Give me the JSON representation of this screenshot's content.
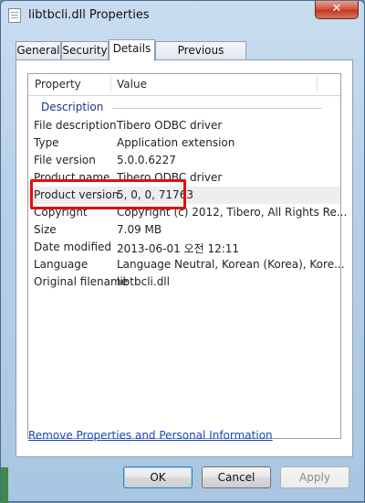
{
  "window": {
    "title": "libtbcli.dll Properties",
    "close_glyph": "✕"
  },
  "tabs": [
    {
      "label": "General"
    },
    {
      "label": "Security"
    },
    {
      "label": "Details",
      "active": true
    },
    {
      "label": "Previous Versions"
    }
  ],
  "list": {
    "columns": {
      "property": "Property",
      "value": "Value"
    },
    "group": "Description",
    "rows": [
      {
        "property": "File description",
        "value": "Tibero ODBC driver"
      },
      {
        "property": "Type",
        "value": "Application extension"
      },
      {
        "property": "File version",
        "value": "5.0.0.6227"
      },
      {
        "property": "Product name",
        "value": "Tibero ODBC driver"
      },
      {
        "property": "Product version",
        "value": "5, 0, 0, 71763",
        "selected": true
      },
      {
        "property": "Copyright",
        "value": "Copyright (c) 2012, Tibero, All Rights Re..."
      },
      {
        "property": "Size",
        "value": "7.09 MB"
      },
      {
        "property": "Date modified",
        "value": "2013-06-01 오전 12:11"
      },
      {
        "property": "Language",
        "value": "Language Neutral, Korean (Korea), Kore..."
      },
      {
        "property": "Original filename",
        "value": "libtbcli.dll"
      }
    ]
  },
  "link": "Remove Properties and Personal Information",
  "buttons": {
    "ok": "OK",
    "cancel": "Cancel",
    "apply": "Apply"
  },
  "colors": {
    "highlight": "#e01010",
    "link": "#1a47b8",
    "group": "#1e3287"
  }
}
